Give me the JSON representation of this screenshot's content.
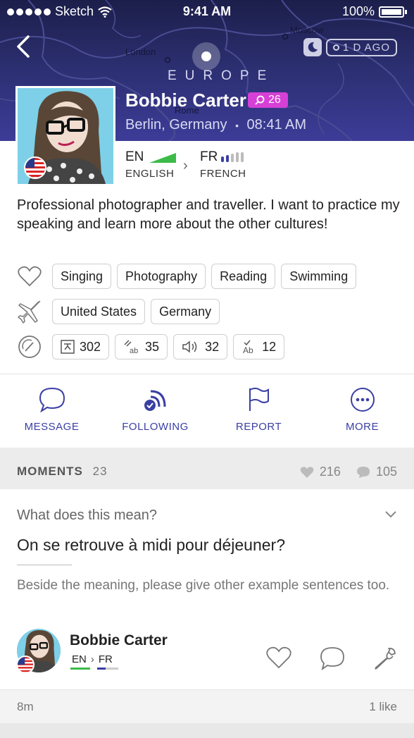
{
  "status_bar": {
    "carrier": "Sketch",
    "time": "9:41 AM",
    "battery": "100%"
  },
  "header": {
    "time_ago": "1 D AGO",
    "map_labels": {
      "region": "EUROPE",
      "city1": "London",
      "city2": "Moscow",
      "city3": "Rome"
    },
    "name": "Bobbie Carter",
    "level": "26",
    "location": "Berlin, Germany",
    "local_time": "08:41 AM",
    "separator": "•"
  },
  "languages": {
    "native": {
      "code": "EN",
      "name": "ENGLISH"
    },
    "learning": {
      "code": "FR",
      "name": "FRENCH"
    }
  },
  "bio": "Professional photographer and traveller. I want to practice my speaking and learn more about the other cultures!",
  "interests": [
    "Singing",
    "Photography",
    "Reading",
    "Swimming"
  ],
  "travel": [
    "United States",
    "Germany"
  ],
  "stats": {
    "translations": "302",
    "transliterations": "35",
    "voice": "32",
    "corrections": "12"
  },
  "actions": {
    "message": "MESSAGE",
    "following": "FOLLOWING",
    "report": "REPORT",
    "more": "MORE"
  },
  "moments": {
    "title": "MOMENTS",
    "count": "23",
    "likes": "216",
    "comments": "105"
  },
  "post": {
    "type": "What does this mean?",
    "question": "On se retrouve à midi pour déjeuner?",
    "note": "Beside the meaning, please give other example sentences too.",
    "author": "Bobbie Carter",
    "native": "EN",
    "learning": "FR",
    "time": "8m",
    "likes": "1 like"
  },
  "colors": {
    "accent": "#3a3fa3",
    "badge": "#d640d6",
    "native_bar": "#3dbb4a",
    "learning_bar": "#3a3fa3"
  }
}
